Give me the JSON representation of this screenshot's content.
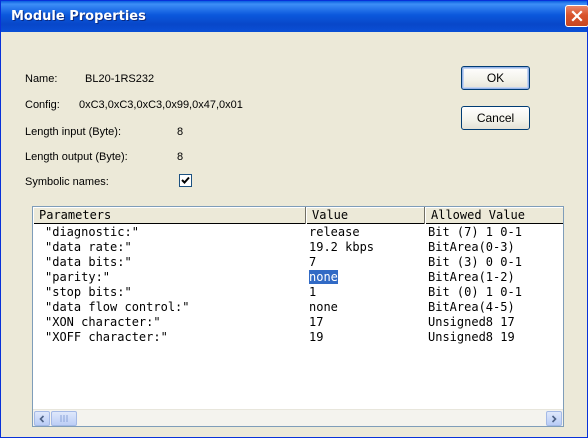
{
  "window": {
    "title": "Module Properties"
  },
  "info": {
    "name_label": "Name:",
    "name_value": "BL20-1RS232",
    "config_label": "Config:",
    "config_value": "0xC3,0xC3,0xC3,0x99,0x47,0x01",
    "length_input_label": "Length input (Byte):",
    "length_input_value": "8",
    "length_output_label": "Length output (Byte):",
    "length_output_value": "8",
    "symbolic_names_label": "Symbolic names:",
    "symbolic_names_checked": true
  },
  "buttons": {
    "ok": "OK",
    "cancel": "Cancel"
  },
  "grid": {
    "columns": [
      "Parameters",
      "Value",
      "Allowed Value"
    ],
    "rows": [
      {
        "param": "\"diagnostic:\"",
        "value": "release",
        "allowed": "Bit (7) 1 0-1"
      },
      {
        "param": "\"data rate:\"",
        "value": "19.2 kbps",
        "allowed": "BitArea(0-3)"
      },
      {
        "param": "\"data bits:\"",
        "value": "7",
        "allowed": "Bit (3) 0 0-1"
      },
      {
        "param": "\"parity:\"",
        "value": "none",
        "allowed": "BitArea(1-2)"
      },
      {
        "param": "\"stop bits:\"",
        "value": "1",
        "allowed": "Bit (0) 1 0-1"
      },
      {
        "param": "\"data flow control:\"",
        "value": "none",
        "allowed": "BitArea(4-5)"
      },
      {
        "param": "\"XON character:\"",
        "value": "17",
        "allowed": "Unsigned8 17"
      },
      {
        "param": "\"XOFF character:\"",
        "value": "19",
        "allowed": "Unsigned8 19"
      }
    ],
    "selected_row": 3
  },
  "colors": {
    "title_bar": "#0b58dc",
    "selection": "#316ac5",
    "close_button": "#d9542c"
  },
  "icons": {
    "close": "close-icon",
    "checkbox": "checkmark-icon",
    "scroll_left": "arrow-left-icon",
    "scroll_right": "arrow-right-icon"
  }
}
